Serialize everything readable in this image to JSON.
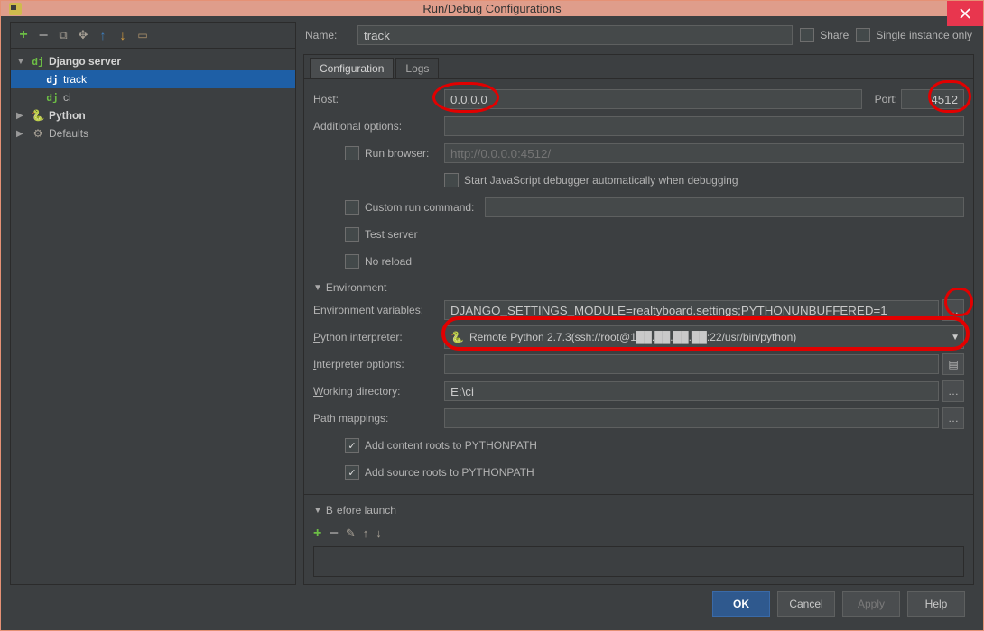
{
  "window": {
    "title": "Run/Debug Configurations"
  },
  "share": {
    "label": "Share",
    "checked": false
  },
  "singleInstance": {
    "label": "Single instance only",
    "checked": false
  },
  "nameRow": {
    "label": "Name:",
    "value": "track"
  },
  "tree": {
    "nodes": [
      {
        "label": "Django server"
      },
      {
        "label": "track"
      },
      {
        "label": "ci"
      },
      {
        "label": "Python"
      },
      {
        "label": "Defaults"
      }
    ]
  },
  "tabs": {
    "configuration": "Configuration",
    "logs": "Logs"
  },
  "form": {
    "host": {
      "label": "Host:",
      "value": "0.0.0.0"
    },
    "port": {
      "label": "Port:",
      "value": "4512"
    },
    "additionalOptions": {
      "label": "Additional options:",
      "value": ""
    },
    "runBrowser": {
      "label": "Run browser:",
      "checked": false,
      "placeholder": "http://0.0.0.0:4512/"
    },
    "jsDebug": {
      "label": "Start JavaScript debugger automatically when debugging",
      "checked": false
    },
    "customRun": {
      "label": "Custom run command:",
      "checked": false,
      "value": ""
    },
    "testServer": {
      "label": "Test server",
      "checked": false
    },
    "noReload": {
      "label": "No reload",
      "checked": false
    },
    "envSection": "Environment",
    "envVars": {
      "label": "Environment variables:",
      "value": "DJANGO_SETTINGS_MODULE=realtyboard.settings;PYTHONUNBUFFERED=1"
    },
    "interpreter": {
      "label": "Python interpreter:",
      "value": "Remote Python 2.7.3(ssh://root@1██.██.██.██:22/usr/bin/python)"
    },
    "interpOptions": {
      "label": "Interpreter options:",
      "value": ""
    },
    "workDir": {
      "label": "Working directory:",
      "value": "E:\\ci"
    },
    "pathMappings": {
      "label": "Path mappings:",
      "value": ""
    },
    "addContent": {
      "label": "Add content roots to PYTHONPATH",
      "checked": true
    },
    "addSource": {
      "label": "Add source roots to PYTHONPATH",
      "checked": true
    },
    "beforeLaunch": "Before launch"
  },
  "buttons": {
    "ok": "OK",
    "cancel": "Cancel",
    "apply": "Apply",
    "help": "Help"
  }
}
